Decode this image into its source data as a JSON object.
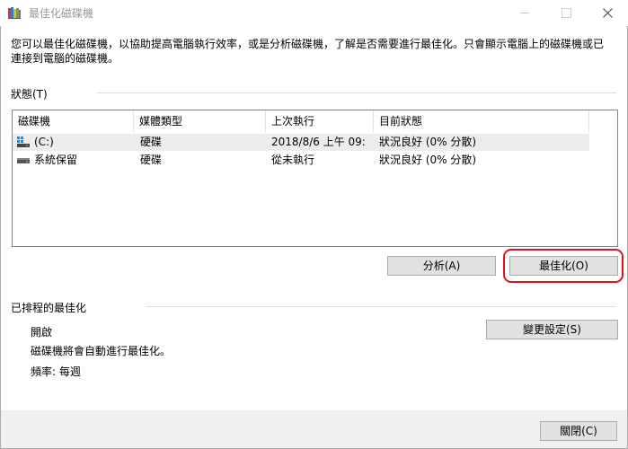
{
  "window": {
    "title": "最佳化磁碟機"
  },
  "description": "您可以最佳化磁碟機，以協助提高電腦執行效率，或是分析磁碟機，了解是否需要進行最佳化。只會顯示電腦上的磁碟機或已連接到電腦的磁碟機。",
  "status": {
    "group_label": "狀態(T)",
    "columns": [
      "磁碟機",
      "媒體類型",
      "上次執行",
      "目前狀態"
    ],
    "rows": [
      {
        "drive": "(C:)",
        "icon": "windows-drive-icon",
        "media": "硬碟",
        "last_run": "2018/8/6 上午 09:",
        "status": "狀況良好 (0% 分散)"
      },
      {
        "drive": "系統保留",
        "icon": "drive-icon",
        "media": "硬碟",
        "last_run": "從未執行",
        "status": "狀況良好 (0% 分散)"
      }
    ],
    "analyze_label": "分析(A)",
    "optimize_label": "最佳化(O)",
    "highlight_color": "#e0131a"
  },
  "scheduled": {
    "group_label": "已排程的最佳化",
    "state": "開啟",
    "change_settings_label": "變更設定(S)",
    "auto_text": "磁碟機將會自動進行最佳化。",
    "frequency_text": "頻率: 每週"
  },
  "footer": {
    "close_label": "關閉(C)"
  }
}
